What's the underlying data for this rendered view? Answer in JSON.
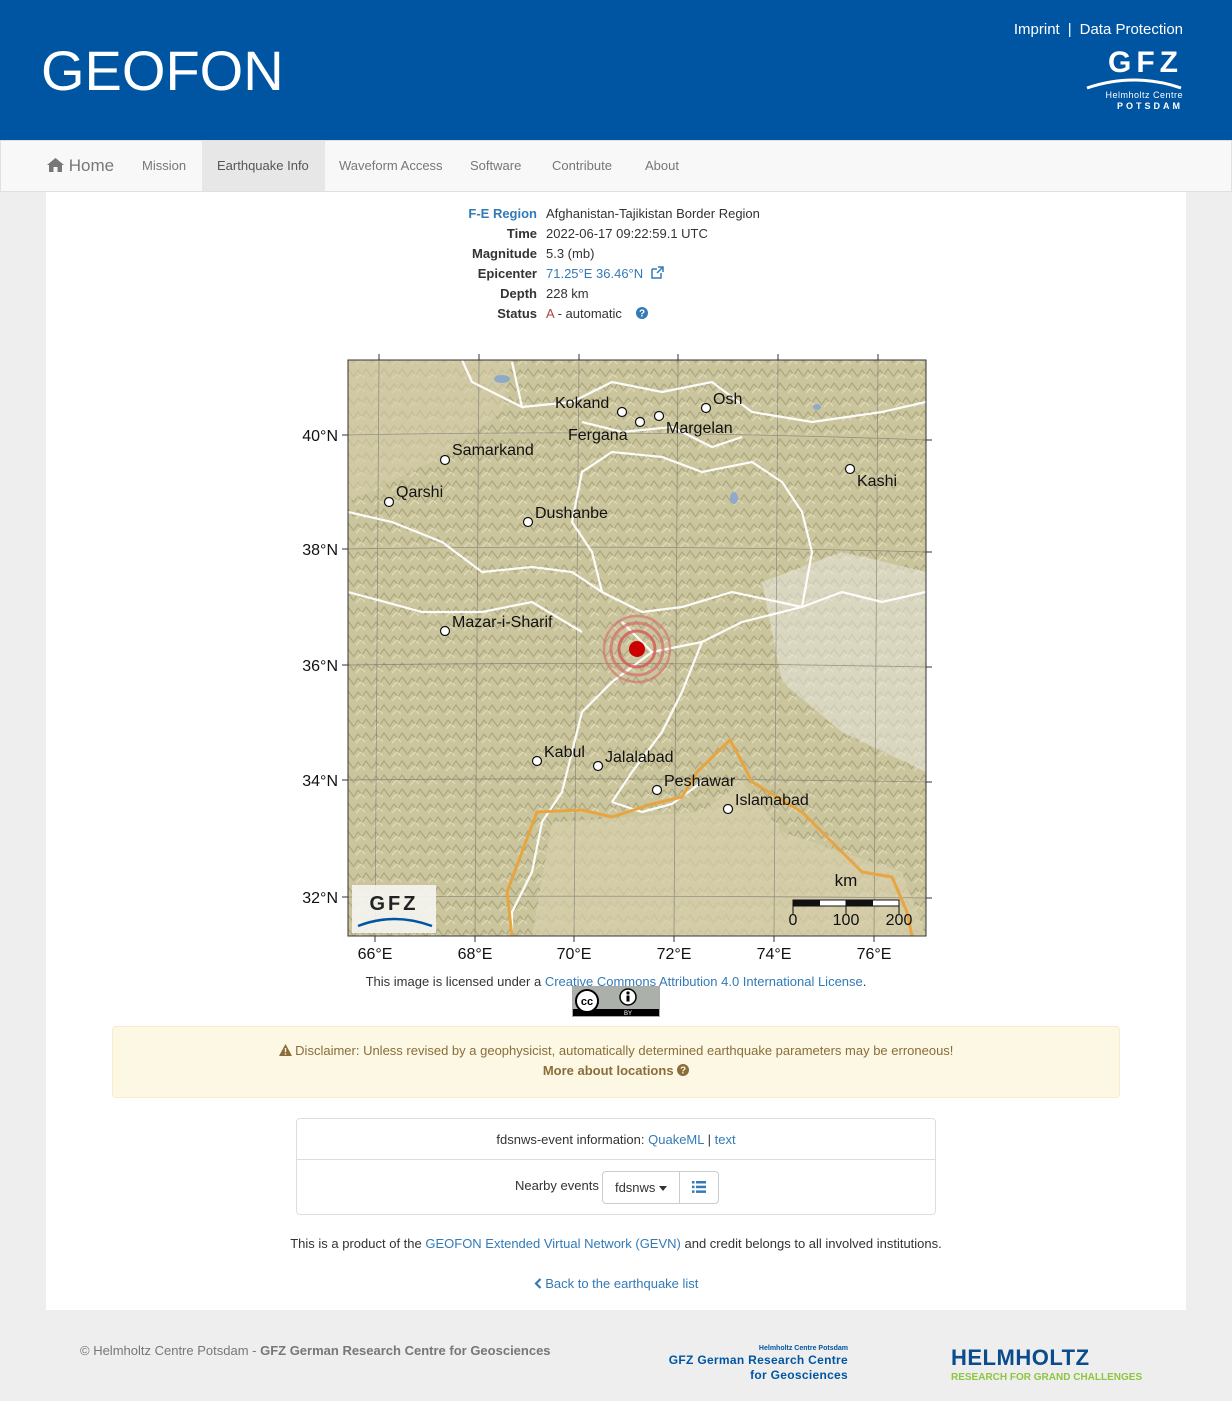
{
  "header": {
    "brand": "GEOFON",
    "imprint": "Imprint",
    "separator": "|",
    "data_protection": "Data Protection",
    "logo_text": "GFZ",
    "logo_sub1": "Helmholtz Centre",
    "logo_sub2": "POTSDAM"
  },
  "nav": {
    "home": "Home",
    "items": [
      "Mission",
      "Earthquake Info",
      "Waveform Access",
      "Software",
      "Contribute",
      "About"
    ],
    "active": "Earthquake Info"
  },
  "event": {
    "fe_region_label": "F-E Region",
    "fe_region": "Afghanistan-Tajikistan Border Region",
    "time_label": "Time",
    "time": "2022-06-17 09:22:59.1 UTC",
    "magnitude_label": "Magnitude",
    "magnitude": "5.3 (mb)",
    "epicenter_label": "Epicenter",
    "epicenter": "71.25°E 36.46°N",
    "depth_label": "Depth",
    "depth": "228 km",
    "status_label": "Status",
    "status_code": "A",
    "status_text": " - automatic"
  },
  "map": {
    "lat_labels": [
      "40°N",
      "38°N",
      "36°N",
      "34°N",
      "32°N"
    ],
    "lon_labels": [
      "66°E",
      "68°E",
      "70°E",
      "72°E",
      "74°E",
      "76°E"
    ],
    "cities": [
      "Kokand",
      "Osh",
      "Fergana",
      "Margelan",
      "Samarkand",
      "Kashi",
      "Qarshi",
      "Dushanbe",
      "Mazar-i-Sharif",
      "Kabul",
      "Jalalabad",
      "Peshawar",
      "Islamabad"
    ],
    "scale_unit": "km",
    "scale_ticks": [
      "0",
      "100",
      "200"
    ],
    "logo": "GFZ",
    "colors": {
      "terrain": "#c9c39e",
      "border": "#ffffff",
      "pak_border": "#e8a33b",
      "epicenter": "#cc0000"
    }
  },
  "license": {
    "prefix": "This image is licensed under a ",
    "link": "Creative Commons Attribution 4.0 International License",
    "suffix": ".",
    "badge_cc": "cc",
    "badge_by": "BY"
  },
  "disclaimer": {
    "text": "Disclaimer: Unless revised by a geophysicist, automatically determined earthquake parameters may be erroneous!",
    "more": "More about locations"
  },
  "fdsn": {
    "label": "fdsnws-event information:",
    "quakeml": "QuakeML",
    "sep": "|",
    "text": "text",
    "nearby_label": "Nearby events",
    "nearby_select": "fdsnws"
  },
  "product": {
    "prefix": "This is a product of the ",
    "link": "GEOFON Extended Virtual Network (GEVN)",
    "suffix": " and credit belongs to all involved institutions."
  },
  "back_link": "Back to the earthquake list",
  "footer": {
    "copy_prefix": "© Helmholtz Centre Potsdam - ",
    "copy_bold": "GFZ German Research Centre for Geosciences",
    "gfz_small": "Helmholtz Centre Potsdam",
    "gfz_line1": "GFZ German Research Centre",
    "gfz_line2": "for Geosciences",
    "helmholtz": "HELMHOLTZ",
    "helmholtz_sub": "RESEARCH FOR GRAND CHALLENGES"
  }
}
